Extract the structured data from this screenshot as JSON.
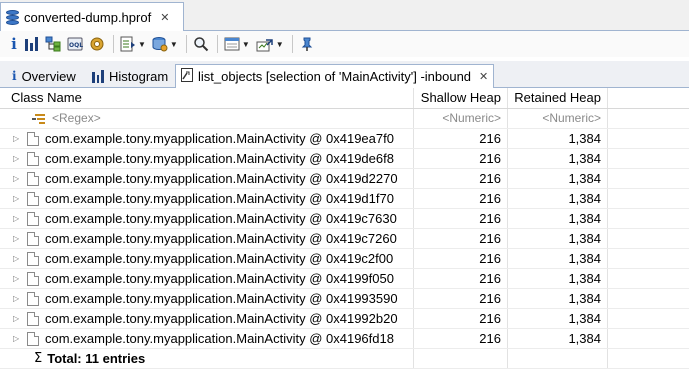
{
  "editor_tab": {
    "title": "converted-dump.hprof",
    "close": "✕"
  },
  "toolbar": {
    "icons": [
      "info-icon",
      "histogram-icon",
      "dominator-tree-icon",
      "oql-icon",
      "heap-dump-overview-icon",
      "run-report-icon",
      "query-browser-icon",
      "find-object-icon",
      "calculate-retained-icon",
      "export-icon",
      "pin-icon"
    ]
  },
  "tabs": [
    {
      "label": "Overview",
      "icon": "i"
    },
    {
      "label": "Histogram",
      "icon": "histogram-icon"
    },
    {
      "label": "list_objects [selection of 'MainActivity'] -inbound",
      "icon": "page-icon"
    }
  ],
  "table": {
    "columns": [
      "Class Name",
      "Shallow Heap",
      "Retained Heap"
    ],
    "filter": {
      "regex": "<Regex>",
      "numeric1": "<Numeric>",
      "numeric2": "<Numeric>"
    },
    "rows": [
      {
        "name": "com.example.tony.myapplication.MainActivity @ 0x419ea7f0",
        "shallow": "216",
        "retained": "1,384"
      },
      {
        "name": "com.example.tony.myapplication.MainActivity @ 0x419de6f8",
        "shallow": "216",
        "retained": "1,384"
      },
      {
        "name": "com.example.tony.myapplication.MainActivity @ 0x419d2270",
        "shallow": "216",
        "retained": "1,384"
      },
      {
        "name": "com.example.tony.myapplication.MainActivity @ 0x419d1f70",
        "shallow": "216",
        "retained": "1,384"
      },
      {
        "name": "com.example.tony.myapplication.MainActivity @ 0x419c7630",
        "shallow": "216",
        "retained": "1,384"
      },
      {
        "name": "com.example.tony.myapplication.MainActivity @ 0x419c7260",
        "shallow": "216",
        "retained": "1,384"
      },
      {
        "name": "com.example.tony.myapplication.MainActivity @ 0x419c2f00",
        "shallow": "216",
        "retained": "1,384"
      },
      {
        "name": "com.example.tony.myapplication.MainActivity @ 0x4199f050",
        "shallow": "216",
        "retained": "1,384"
      },
      {
        "name": "com.example.tony.myapplication.MainActivity @ 0x41993590",
        "shallow": "216",
        "retained": "1,384"
      },
      {
        "name": "com.example.tony.myapplication.MainActivity @ 0x41992b20",
        "shallow": "216",
        "retained": "1,384"
      },
      {
        "name": "com.example.tony.myapplication.MainActivity @ 0x4196fd18",
        "shallow": "216",
        "retained": "1,384"
      }
    ],
    "total": {
      "sigma": "Σ",
      "label": "Total: 11 entries"
    }
  },
  "colors": {
    "accent": "#1d3f7a",
    "tab_border": "#a0b4d0"
  }
}
